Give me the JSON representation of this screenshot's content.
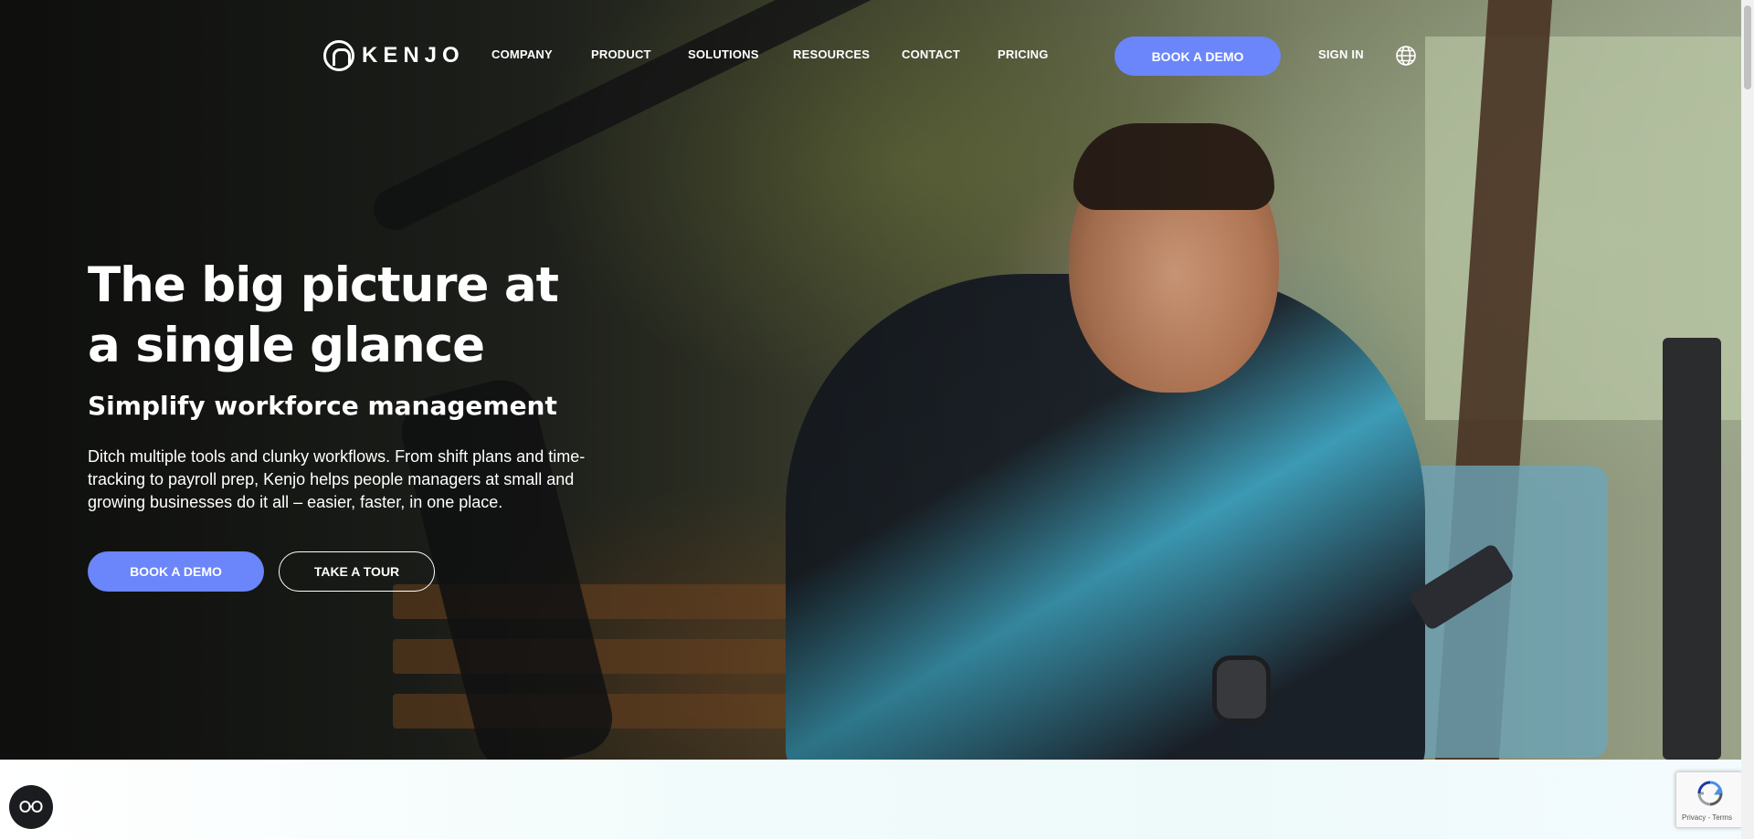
{
  "nav": {
    "logo_text": "KENJO",
    "links": [
      "COMPANY",
      "PRODUCT",
      "SOLUTIONS",
      "RESOURCES",
      "CONTACT",
      "PRICING"
    ],
    "book_demo": "BOOK A DEMO",
    "sign_in": "SIGN IN",
    "language_icon": "globe-icon"
  },
  "hero": {
    "title": "The big picture at a single glance",
    "subtitle": "Simplify workforce management",
    "body": "Ditch multiple tools and clunky workflows. From shift plans and time-tracking to payroll prep, Kenjo helps people managers at small and growing businesses do it all – easier, faster, in one place.",
    "primary_button": "BOOK A DEMO",
    "secondary_button": "TAKE A TOUR",
    "image_alt": "smiling man with phone sitting on bench"
  },
  "recaptcha": {
    "text": "Privacy - Terms"
  },
  "colors": {
    "accent": "#6b85fa",
    "text_on_dark": "#ffffff",
    "fab_bg": "#1b1c1f"
  }
}
